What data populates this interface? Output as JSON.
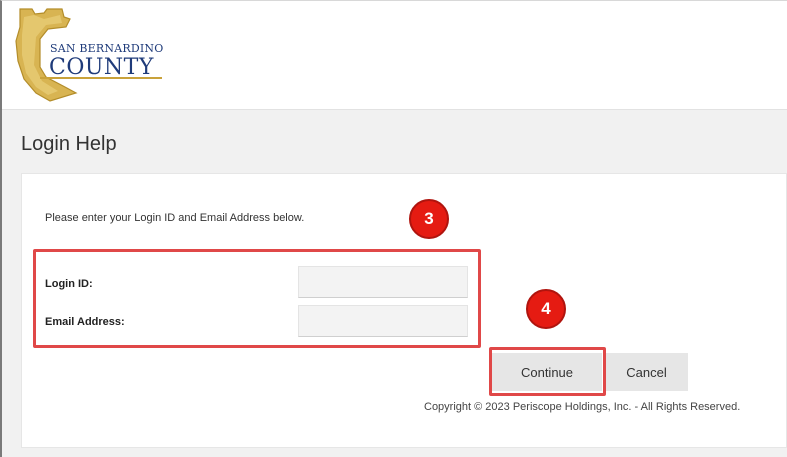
{
  "header": {
    "logo": {
      "line1": "SAN BERNARDINO",
      "line2": "COUNTY"
    }
  },
  "page": {
    "title": "Login Help",
    "instructions": "Please enter your Login ID and Email Address below."
  },
  "form": {
    "login_id": {
      "label": "Login ID:",
      "value": "",
      "placeholder": ""
    },
    "email": {
      "label": "Email Address:",
      "value": "",
      "placeholder": ""
    }
  },
  "buttons": {
    "continue_label": "Continue",
    "cancel_label": "Cancel"
  },
  "annotations": {
    "step_fields": "3",
    "step_continue": "4"
  },
  "footer": {
    "copyright": "Copyright © 2023 Periscope Holdings, Inc. - All Rights Reserved."
  },
  "colors": {
    "accent_gold": "#c9a23a",
    "brand_blue": "#1f3b7a",
    "highlight_red": "#e04848",
    "badge_red": "#e51b12"
  }
}
